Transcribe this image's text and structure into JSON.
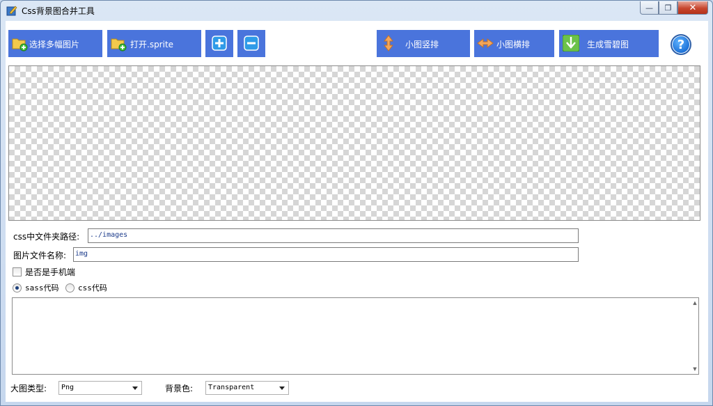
{
  "window": {
    "title": "Css背景图合并工具",
    "minimize": "—",
    "restore": "❐",
    "close": "✕"
  },
  "toolbar": {
    "select_images": "选择多幅图片",
    "open_sprite": "打开.sprite",
    "add": "+",
    "remove": "−",
    "vertical": "小图竖排",
    "horizontal": "小图横排",
    "generate": "生成雪碧图",
    "help": "?"
  },
  "form": {
    "css_path_label": "css中文件夹路径:",
    "css_path_value": "../images",
    "image_name_label": "图片文件名称:",
    "image_name_value": "img",
    "mobile_label": "是否是手机端",
    "mobile_checked": false,
    "sass_label": "sass代码",
    "css_label": "css代码",
    "selected_code_type": "sass"
  },
  "bottom": {
    "image_type_label": "大图类型:",
    "image_type_value": "Png",
    "bg_color_label": "背景色:",
    "bg_color_value": "Transparent"
  },
  "colors": {
    "toolbar_button": "#4a74dc",
    "help_icon": "#1a6fd6",
    "input_text": "#1a3a8a"
  }
}
